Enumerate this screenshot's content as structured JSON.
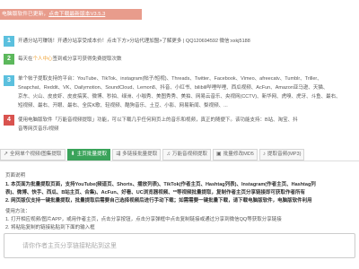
{
  "banner": {
    "prefix": "电脑版软件已更新，",
    "link": "点击下载最新版本V3.5.3"
  },
  "notices": [
    {
      "num": "1",
      "text": "开通分站可赚钱！开通分站享受成本价！点击下方>分站代理加盟>了解更多 | QQ120694592 微信:xxkj5188"
    },
    {
      "num": "2",
      "text_before": "每天在",
      "highlight": "个人中心",
      "text_after": "签到或分享可获得免费提取次数"
    },
    {
      "num": "3",
      "lines": [
        "单个帖子提取支持的平台：YouTube、TikTok、instagram(帖子/短视)、Threads、Twitter、Facebook、Vimeo、afreecatv、Tumblr、Triller、",
        "Snapchat、Reddit、VK、Dailymotion、SoundCloud、Lemon8、抖音、小红书、bilibili哔哩哔哩、西瓜视频、AcFun、Amazon亚马逊、天猫、",
        "京东、火山、皮皮虾、皮皮搞笑、微博、秒拍、绿洲、小咖秀、美图秀秀、美拍、网易云音乐、央视网(CCTV)、新华网、虎嗅、虎牙、斗鱼、最右、",
        "短视频、最右、开眼、最右、全民K歌、轻视频、酷狗音乐、土豆、小影、网易新闻、梨视频、..."
      ]
    },
    {
      "num": "4",
      "lines": [
        "使用电脑版软件「万能音视频提取」功能，可以下载几乎任何网页上的音乐和视频，真正的随便下。该功能支持：B站、淘宝、抖",
        "音等网页音乐/视频"
      ]
    }
  ],
  "tabs": [
    {
      "icon": "share-icon",
      "glyph": "↗",
      "label": "全网单个视频/图集提取",
      "active": false
    },
    {
      "icon": "download-icon",
      "glyph": "⬇",
      "label": "主页批量提取",
      "active": true
    },
    {
      "icon": "link-icon",
      "glyph": "⇶",
      "label": "多链接批量提取",
      "active": false
    },
    {
      "icon": "music-icon",
      "glyph": "♫",
      "label": "万能音视频提取",
      "active": false
    },
    {
      "icon": "image-icon",
      "glyph": "▣",
      "label": "批量修改MD5",
      "active": false
    },
    {
      "icon": "audio-icon",
      "glyph": "♪",
      "label": "提取音频(MP3)",
      "active": false
    }
  ],
  "section": {
    "title": "页面说明",
    "desc": [
      "1. 本页面为批量提取页面，支持YouTube(频道页、Shorts、播放列表)、TikTok(作者主页、Hashtag列表)、Instagram(作者主页、Hashtag列",
      "表)、微博、快手、西瓜、B站主页、合集)、AcFun、好看、UC浏览器视频、**等视频批量提取，复制作者主页分享链接即可获取作者所有",
      "2. 网页版仅支持一键批量提取，批量提取后需要自己选择视频后进行手动下载；如需需要一键批量下载，请下载电脑版软件，电脑版软件利用"
    ],
    "usage_title": "使用方法：",
    "usage": [
      "1. 打开相应视频/图片APP，或用作者主页，点击分享按钮，点击分享弹框中点击复制链接或通过分享到微信QQ等获取分享链接",
      "2. 将粘贴复制的链接粘贴到下面的输入框"
    ]
  },
  "input": {
    "placeholder": "请你作者主页分享链接粘贴到这里"
  }
}
